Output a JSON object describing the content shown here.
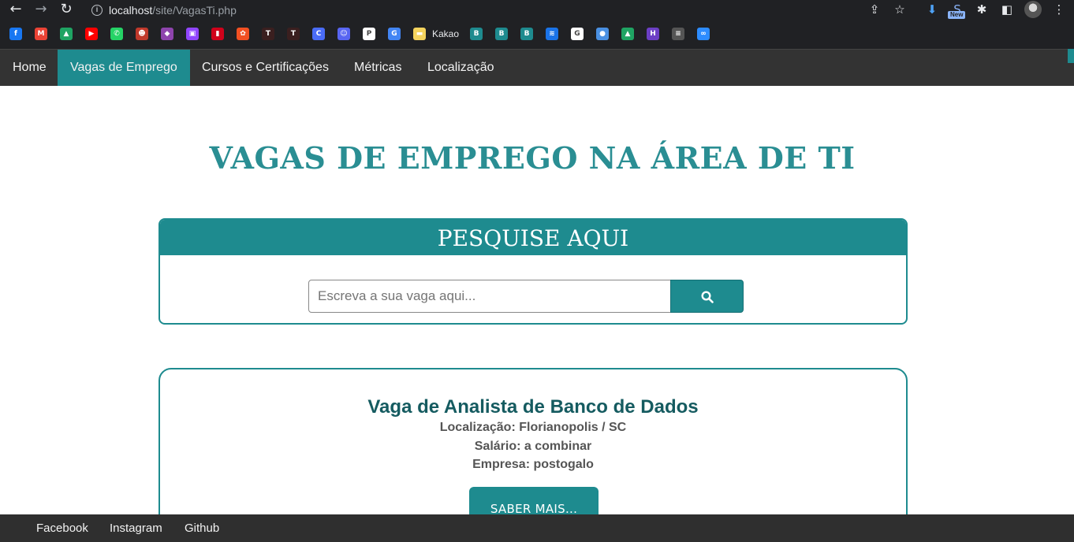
{
  "browser": {
    "url_host": "localhost",
    "url_path": "/site/VagasTi.php",
    "new_badge": "New",
    "bookmarks": [
      {
        "icon": "facebook-icon",
        "color": "#1877f2",
        "glyph": "f"
      },
      {
        "icon": "gmail-icon",
        "color": "#ea4335",
        "glyph": "M"
      },
      {
        "icon": "google-drive-icon",
        "color": "#1fa463",
        "glyph": "▲"
      },
      {
        "icon": "youtube-icon",
        "color": "#ff0000",
        "glyph": "▶"
      },
      {
        "icon": "whatsapp-icon",
        "color": "#25d366",
        "glyph": "✆"
      },
      {
        "icon": "avatar-bookmark-icon",
        "color": "#c0392b",
        "glyph": "☻"
      },
      {
        "icon": "crystal-icon",
        "color": "#8e44ad",
        "glyph": "◆"
      },
      {
        "icon": "twitch-icon",
        "color": "#9146ff",
        "glyph": "▣"
      },
      {
        "icon": "red-book-icon",
        "color": "#d0021b",
        "glyph": "▮"
      },
      {
        "icon": "orange-swirl-icon",
        "color": "#f25022",
        "glyph": "✿"
      },
      {
        "icon": "tgs-icon",
        "color": "#3a1f1f",
        "glyph": "T"
      },
      {
        "icon": "tgs-icon",
        "color": "#3a1f1f",
        "glyph": "T"
      },
      {
        "icon": "c-logo-icon",
        "color": "#4a6cf7",
        "glyph": "C"
      },
      {
        "icon": "discord-icon",
        "color": "#5865f2",
        "glyph": "☺"
      },
      {
        "icon": "pj-icon",
        "color": "#ffffff",
        "glyph": "P"
      },
      {
        "icon": "google-translate-icon",
        "color": "#4285f4",
        "glyph": "G"
      },
      {
        "icon": "folder-icon",
        "color": "#f4d35e",
        "glyph": "▬"
      }
    ],
    "bookmark_label": "Kakao",
    "bookmarks_after": [
      {
        "icon": "b-logo-icon",
        "color": "#1e8b8f",
        "glyph": "B"
      },
      {
        "icon": "b-logo-icon",
        "color": "#1e8b8f",
        "glyph": "B"
      },
      {
        "icon": "b-logo-icon",
        "color": "#1e8b8f",
        "glyph": "B"
      },
      {
        "icon": "stack-icon",
        "color": "#1a73e8",
        "glyph": "≋"
      },
      {
        "icon": "google-icon",
        "color": "#ffffff",
        "glyph": "G"
      },
      {
        "icon": "chat-bubble-icon",
        "color": "#4a90e2",
        "glyph": "●"
      },
      {
        "icon": "google-drive-icon",
        "color": "#1fa463",
        "glyph": "▲"
      },
      {
        "icon": "h-logo-icon",
        "color": "#6c3fc5",
        "glyph": "H"
      },
      {
        "icon": "text-logo-icon",
        "color": "#555555",
        "glyph": "≡"
      },
      {
        "icon": "loop-icon",
        "color": "#2d8cff",
        "glyph": "∞"
      }
    ]
  },
  "nav": {
    "items": [
      {
        "label": "Home",
        "active": false
      },
      {
        "label": "Vagas de Emprego",
        "active": true
      },
      {
        "label": "Cursos e Certificações",
        "active": false
      },
      {
        "label": "Métricas",
        "active": false
      },
      {
        "label": "Localização",
        "active": false
      }
    ]
  },
  "page": {
    "title": "VAGAS DE EMPREGO NA ÁREA DE TI"
  },
  "search": {
    "heading": "PESQUISE AQUI",
    "placeholder": "Escreva a sua vaga aqui...",
    "value": ""
  },
  "job": {
    "title": "Vaga de Analista de Banco de Dados",
    "location": "Localização: Florianopolis / SC",
    "salary": "Salário: a combinar",
    "company": "Empresa: postogalo",
    "button_label": "SABER MAIS..."
  },
  "footer": {
    "links": [
      "Facebook",
      "Instagram",
      "Github"
    ]
  },
  "colors": {
    "accent": "#1e8b8f",
    "title": "#2a8e93",
    "nav_bg": "#333333"
  }
}
